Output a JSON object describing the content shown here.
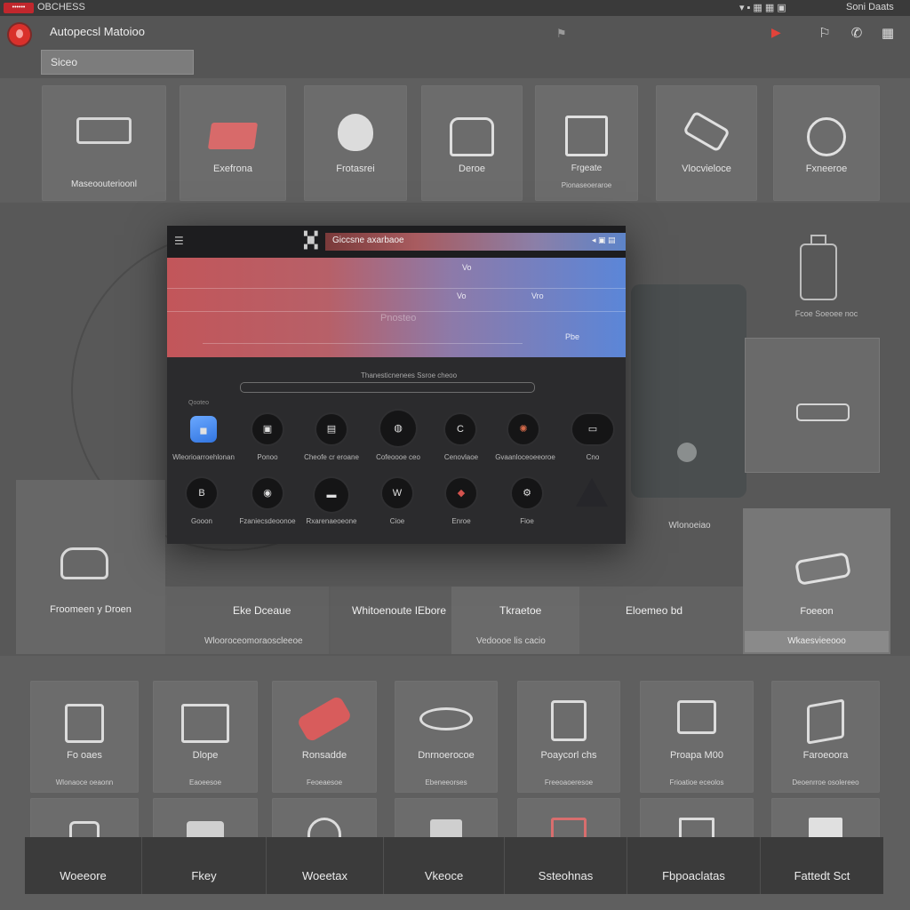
{
  "status_bar": {
    "badge": "••••••",
    "app_name": "OBCHESS",
    "icons": "▾▪▦▦▣",
    "clock": "Soni Daats"
  },
  "header": {
    "title": "Autopecsl Matoioo",
    "search_value": "Siceo"
  },
  "top_row": [
    {
      "label": "",
      "sub": "Maseoouterioonl",
      "icon": "battery-icon"
    },
    {
      "label": "Exefrona",
      "sub": "",
      "icon": "card-icon"
    },
    {
      "label": "Frotasrei",
      "sub": "",
      "icon": "shield-icon"
    },
    {
      "label": "Deroe",
      "sub": "",
      "icon": "scanner-icon"
    },
    {
      "label": "Frgeate",
      "sub": "Pionaseoeraroe",
      "icon": "engine-icon"
    },
    {
      "label": "Vlocvieloce",
      "sub": "",
      "icon": "sensor-icon"
    },
    {
      "label": "Fxneeroe",
      "sub": "",
      "icon": "gauge-icon"
    }
  ],
  "modal": {
    "tab_title": "Giccsne axarbaoe",
    "tab_icons": "◂ ▣ ▤",
    "hero_texts": [
      "Vo",
      "Vo",
      "Vro",
      "Pnosteo",
      "Pbe"
    ],
    "caption": "Thanesticnenees Ssroe cheoo",
    "section_label": "Qooteo",
    "apps_row1": [
      {
        "label": "Wleorioarroehlonan",
        "glyph": "◼"
      },
      {
        "label": "Ponoo",
        "glyph": "▣"
      },
      {
        "label": "Cheofe cr eroane",
        "glyph": "▤"
      },
      {
        "label": "Cofeoooe ceo",
        "glyph": "◍"
      },
      {
        "label": "Cenovlaoe",
        "glyph": "C"
      },
      {
        "label": "Gvaanloceoeeoroe",
        "glyph": "✺"
      },
      {
        "label": "Cno",
        "glyph": "▭"
      }
    ],
    "apps_row2": [
      {
        "label": "Gooon",
        "glyph": "B"
      },
      {
        "label": "Fzaniecsdeoonoe",
        "glyph": "◉"
      },
      {
        "label": "Rxarenaeoeone",
        "glyph": "▬"
      },
      {
        "label": "Cioe",
        "glyph": "W"
      },
      {
        "label": "Enroe",
        "glyph": "◆"
      },
      {
        "label": "Fioe",
        "glyph": "⚙"
      },
      {
        "label": "",
        "glyph": ""
      }
    ]
  },
  "background_labels": {
    "bottle": "Fcoe Soeoee noc",
    "strip_right": "Wlonoeiao",
    "left_panel": "Froomeen y Droen",
    "strip_cells": [
      "Eke Dceaue",
      "Whitoenoute IEbore",
      "Tkraetoe",
      "Eloemeo bd"
    ],
    "strip_sub_left": "Wlooroceomoraoscleeoe",
    "strip_sub_mid": "Vedoooe lis cacio",
    "right_big": "Foeeon",
    "right_big_sub": "Wkaesvieeooo"
  },
  "mid_row": [
    {
      "label": "Fo oaes",
      "sub": "Wlonaoce oeaonn"
    },
    {
      "label": "Dlope",
      "sub": "Eaoeesoe"
    },
    {
      "label": "Ronsadde",
      "sub": "Feoeaesoe"
    },
    {
      "label": "Dnrnoerocoe",
      "sub": "Ebeneeorses"
    },
    {
      "label": "Poaycorl chs",
      "sub": "Freeoaoeresoe"
    },
    {
      "label": "Proapa M00",
      "sub": "Frioatioe eceolos"
    },
    {
      "label": "Faroeoora",
      "sub": "Deoenrroe osolereeo"
    }
  ],
  "dock": [
    "Woeeore",
    "Fkey",
    "Woeetax",
    "Vkeoce",
    "Ssteohnas",
    "Fbpoaclatas",
    "Fattedt Sct"
  ],
  "colors": {
    "accent_red": "#d9302b",
    "hero_start": "#c2565a",
    "hero_end": "#5b86d8",
    "dock": "#3b3b3b"
  }
}
